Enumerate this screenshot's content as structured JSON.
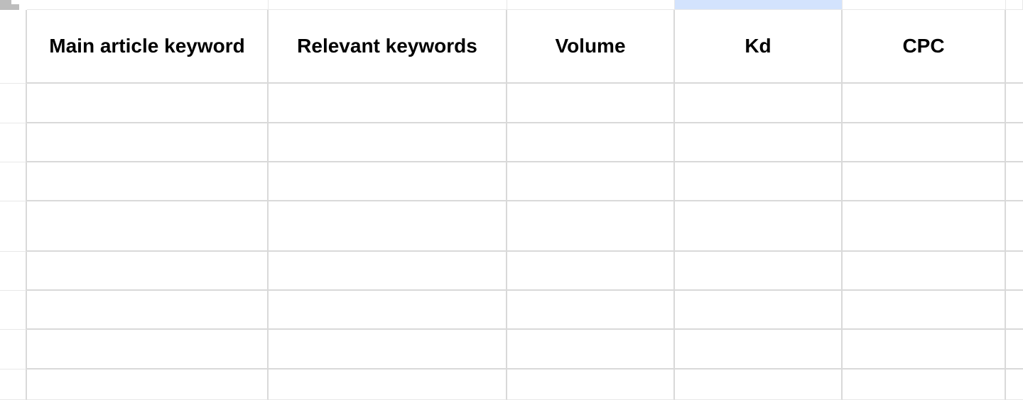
{
  "spreadsheet": {
    "selected_column_index": 3,
    "columns": [
      {
        "label": "Main article keyword"
      },
      {
        "label": "Relevant keywords"
      },
      {
        "label": "Volume"
      },
      {
        "label": "Kd"
      },
      {
        "label": "CPC"
      }
    ],
    "rows": [
      {
        "cells": [
          "",
          "",
          "",
          "",
          ""
        ]
      },
      {
        "cells": [
          "",
          "",
          "",
          "",
          ""
        ]
      },
      {
        "cells": [
          "",
          "",
          "",
          "",
          ""
        ]
      },
      {
        "cells": [
          "",
          "",
          "",
          "",
          ""
        ]
      },
      {
        "cells": [
          "",
          "",
          "",
          "",
          ""
        ]
      },
      {
        "cells": [
          "",
          "",
          "",
          "",
          ""
        ]
      },
      {
        "cells": [
          "",
          "",
          "",
          "",
          ""
        ]
      },
      {
        "cells": [
          "",
          "",
          "",
          "",
          ""
        ]
      }
    ]
  }
}
